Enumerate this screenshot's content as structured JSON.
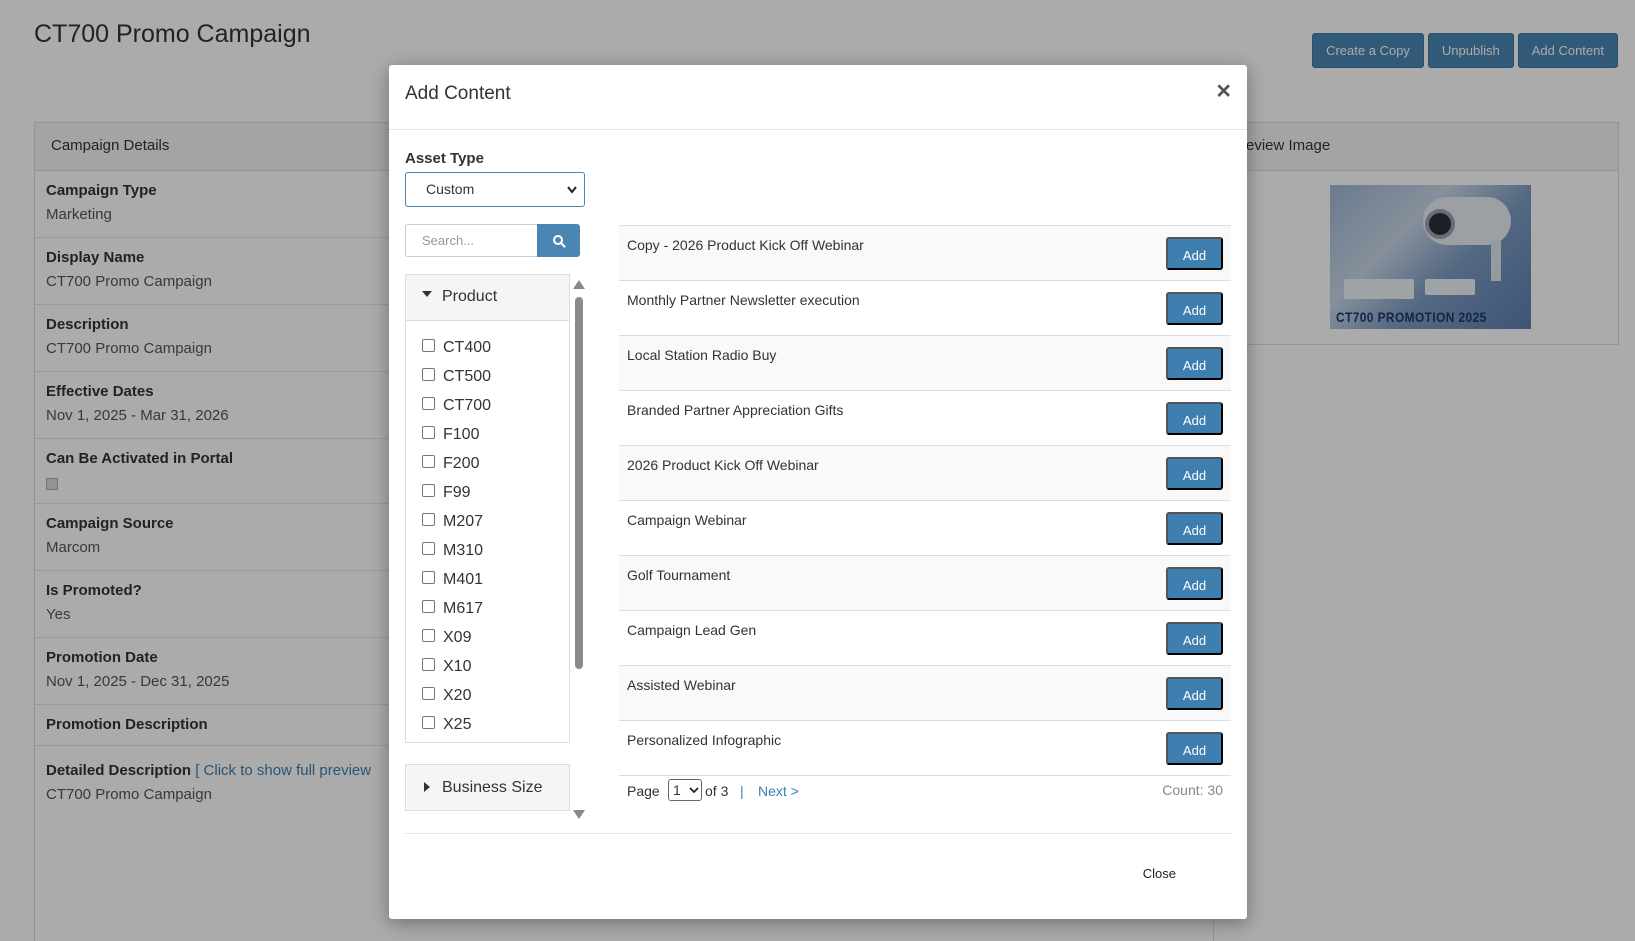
{
  "page": {
    "title": "CT700 Promo Campaign",
    "actions": [
      "Create a Copy",
      "Unpublish",
      "Add Content"
    ]
  },
  "campaign_panel": {
    "header": "Campaign Details",
    "fields": [
      {
        "label": "Campaign Type",
        "value": "Marketing"
      },
      {
        "label": "Display Name",
        "value": "CT700 Promo Campaign"
      },
      {
        "label": "Description",
        "value": "CT700 Promo Campaign"
      },
      {
        "label": "Effective Dates",
        "value": "Nov 1, 2025 - Mar 31, 2026"
      },
      {
        "label": "Can Be Activated in Portal",
        "value": ""
      },
      {
        "label": "Campaign Source",
        "value": "Marcom"
      },
      {
        "label": "Is Promoted?",
        "value": "Yes"
      },
      {
        "label": "Promotion Date",
        "value": "Nov 1, 2025 - Dec 31, 2025"
      },
      {
        "label": "Promotion Description",
        "value": ""
      }
    ],
    "detailed_description": {
      "label": "Detailed Description",
      "link": "[ Click to show full preview",
      "value": "CT700 Promo Campaign"
    }
  },
  "preview_panel": {
    "header": "Preview Image",
    "image_caption": "CT700 PROMOTION 2025"
  },
  "modal": {
    "title": "Add Content",
    "close_icon": "×",
    "asset_type_label": "Asset Type",
    "asset_type_value": "Custom",
    "search_placeholder": "Search...",
    "filters": {
      "product_label": "Product",
      "products": [
        "CT400",
        "CT500",
        "CT700",
        "F100",
        "F200",
        "F99",
        "M207",
        "M310",
        "M401",
        "M617",
        "X09",
        "X10",
        "X20",
        "X25"
      ],
      "business_size_label": "Business Size"
    },
    "add_label": "Add",
    "content_items": [
      "Copy - 2026 Product Kick Off Webinar",
      "Monthly Partner Newsletter execution",
      "Local Station Radio Buy",
      "Branded Partner Appreciation Gifts",
      "2026 Product Kick Off Webinar",
      "Campaign Webinar",
      "Golf Tournament",
      "Campaign Lead Gen",
      "Assisted Webinar",
      "Personalized Infographic"
    ],
    "pager": {
      "page_label": "Page",
      "current_page": "1",
      "of_label": "of 3",
      "separator": "|",
      "next_label": "Next >",
      "count_label": "Count: 30"
    },
    "close_button": "Close"
  }
}
